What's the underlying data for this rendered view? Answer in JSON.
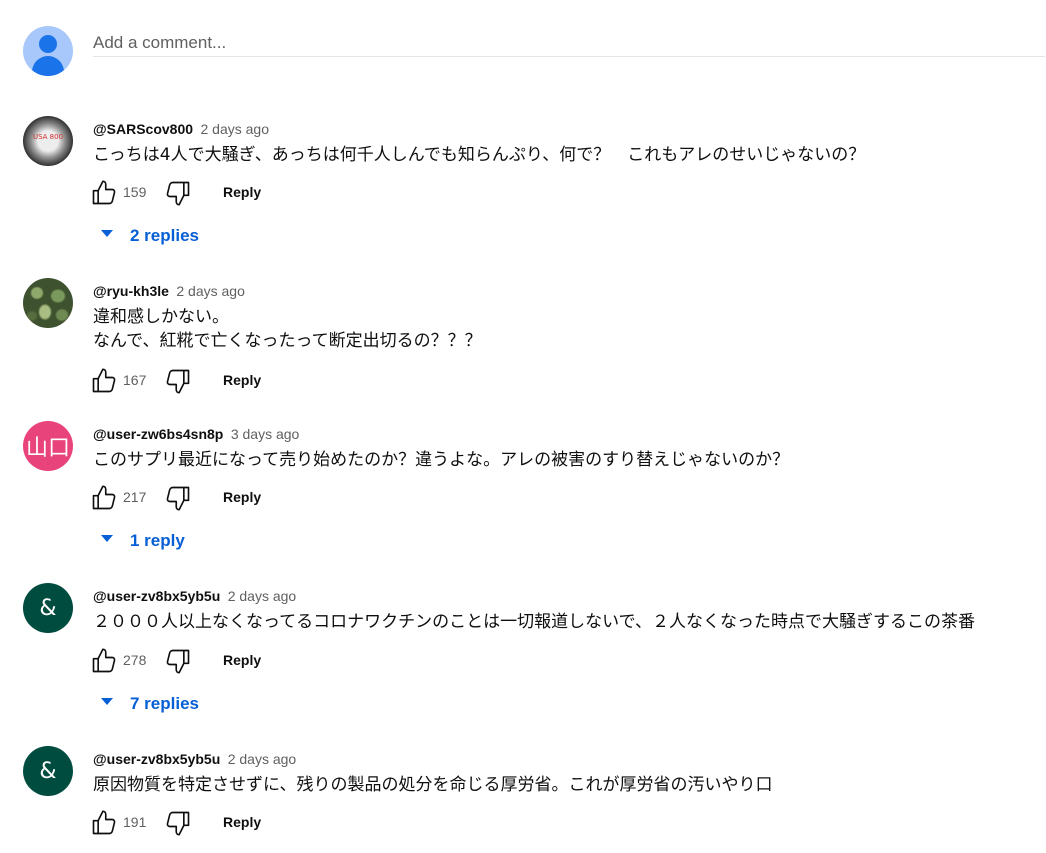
{
  "add_comment": {
    "placeholder": "Add a comment..."
  },
  "reply_label": "Reply",
  "comments": [
    {
      "author": "@SARScov800",
      "time": "2 days ago",
      "avatar_text": "USA 800",
      "lines": [
        "こっちは4人で大騒ぎ、あっちは何千人しんでも知らんぷり、何で？　これもアレのせいじゃないの？"
      ],
      "likes": "159",
      "replies": "2 replies"
    },
    {
      "author": "@ryu-kh3le",
      "time": "2 days ago",
      "lines": [
        "違和感しかない。",
        "なんで、紅糀で亡くなったって断定出切るの？？？"
      ],
      "likes": "167"
    },
    {
      "author": "@user-zw6bs4sn8p",
      "time": "3 days ago",
      "avatar_text": "山口",
      "lines": [
        "このサプリ最近になって売り始めたのか？違うよな。アレの被害のすり替えじゃないのか？"
      ],
      "likes": "217",
      "replies": "1 reply"
    },
    {
      "author": "@user-zv8bx5yb5u",
      "time": "2 days ago",
      "avatar_text": "&",
      "lines": [
        "２０００人以上なくなってるコロナワクチンのことは一切報道しないで、２人なくなった時点で大騒ぎするこの茶番"
      ],
      "likes": "278",
      "replies": "7 replies"
    },
    {
      "author": "@user-zv8bx5yb5u",
      "time": "2 days ago",
      "avatar_text": "&",
      "lines": [
        "原因物質を特定させずに、残りの製品の処分を命じる厚労省。これが厚労省の汚いやり口"
      ],
      "likes": "191"
    }
  ]
}
